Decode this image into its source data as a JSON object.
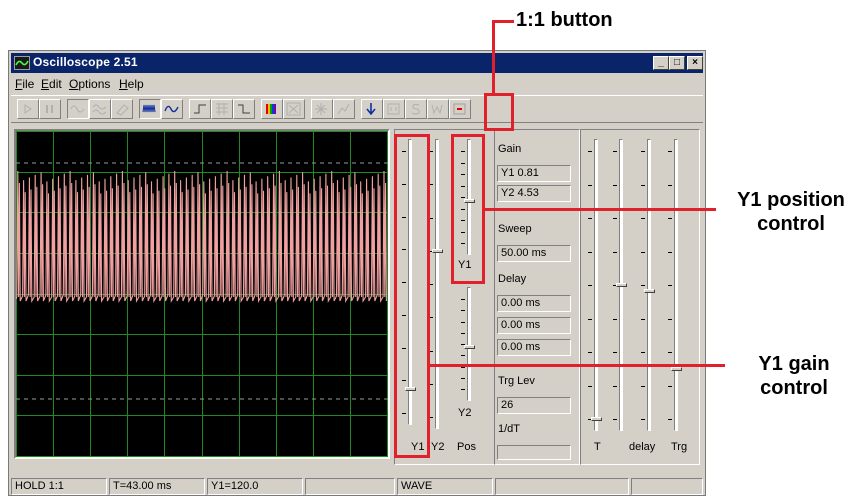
{
  "window": {
    "title": "Oscilloscope 2.51",
    "controls": [
      "_",
      "□",
      "×"
    ]
  },
  "menu": [
    {
      "label": "File",
      "u": "F",
      "rest": "ile"
    },
    {
      "label": "Edit",
      "u": "E",
      "rest": "dit"
    },
    {
      "label": "Options",
      "u": "O",
      "rest": "ptions"
    },
    {
      "label": "Help",
      "u": "H",
      "rest": "elp"
    }
  ],
  "toolbar": {
    "icons": [
      "play-icon",
      "pause-icon",
      "sine-wave-icon",
      "noise-wave-icon",
      "eraser-icon",
      "pulse-train-icon",
      "sine-icon",
      "rise-edge-icon",
      "grid-icon",
      "fall-edge-icon",
      "color-bars-icon",
      "xy-icon",
      "sparkle-icon",
      "save-chart-icon",
      "download-icon",
      "one-to-one-icon",
      "s-icon",
      "w-icon",
      "record-icon"
    ]
  },
  "scope": {
    "colors": {
      "grid": "#1f8a1f",
      "trace": "#f0a0a0",
      "background": "#000000"
    }
  },
  "controls": {
    "gain_label": "Gain",
    "y1_gain": "Y1  0.81",
    "y2_gain": "Y2  4.53",
    "sweep_label": "Sweep",
    "sweep_value": "50.00 ms",
    "delay_label": "Delay",
    "delay_values": [
      "0.00 ms",
      "0.00 ms",
      "0.00 ms"
    ],
    "trg_lev_label": "Trg Lev",
    "trg_lev_value": "26",
    "dt_label": "1/dT",
    "dt_value": "",
    "y1_slider_label": "Y1",
    "y2_pos_label": "Y2",
    "slider_bottom_labels": [
      "Y1",
      "Y2",
      "Pos"
    ],
    "right_labels": [
      "T",
      "delay",
      "Trg"
    ]
  },
  "status": {
    "hold": "HOLD 1:1",
    "time": "T=43.00 ms",
    "y1": "Y1=120.0",
    "empty1": "",
    "mode": "WAVE",
    "empty2": "",
    "empty3": ""
  },
  "annotations": {
    "one_to_one": "1:1 button",
    "y1_position": "Y1 position\ncontrol",
    "y1_gain": "Y1 gain\ncontrol"
  }
}
